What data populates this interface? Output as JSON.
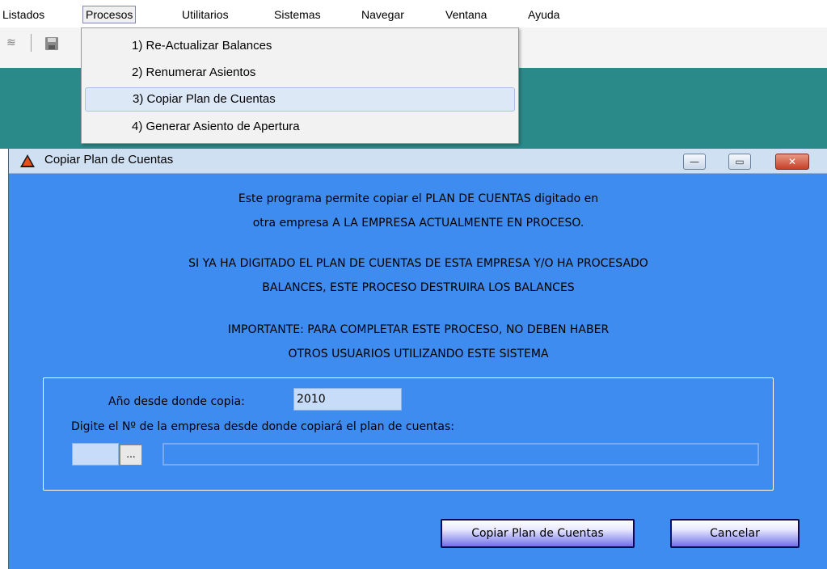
{
  "menubar": {
    "items": [
      "Listados",
      "Procesos",
      "Utilitarios",
      "Sistemas",
      "Navegar",
      "Ventana",
      "Ayuda"
    ]
  },
  "toolbar": {
    "icons": [
      "tools-icon",
      "save-icon"
    ]
  },
  "dropdown": {
    "items": [
      "1) Re-Actualizar Balances",
      "2) Renumerar Asientos",
      "3) Copiar Plan de Cuentas",
      "4) Generar Asiento de Apertura"
    ],
    "highlighted_index": 2
  },
  "dialog": {
    "title": "Copiar Plan de Cuentas",
    "controls": {
      "minimize": "—",
      "maximize": "▭",
      "close": "✕"
    },
    "messages": [
      "Este programa permite copiar el PLAN DE CUENTAS digitado en",
      "otra empresa A LA EMPRESA ACTUALMENTE EN PROCESO.",
      "SI YA HA DIGITADO EL PLAN DE CUENTAS DE ESTA EMPRESA Y/O HA PROCESADO",
      "BALANCES, ESTE PROCESO DESTRUIRA LOS BALANCES",
      "IMPORTANTE: PARA COMPLETAR ESTE PROCESO, NO DEBEN HABER",
      "OTROS USUARIOS UTILIZANDO ESTE SISTEMA"
    ],
    "form": {
      "year_label": "Año desde donde copia:",
      "year_value": "2010",
      "company_label": "Digite el Nº de la empresa desde donde copiará el plan de cuentas:",
      "company_value": "",
      "browse_label": "...",
      "company_name_value": ""
    },
    "buttons": {
      "copy": "Copiar Plan de Cuentas",
      "cancel": "Cancelar"
    }
  },
  "colors": {
    "dialog_bg": "#3f8cf0",
    "desktop": "#2a8a8a"
  }
}
